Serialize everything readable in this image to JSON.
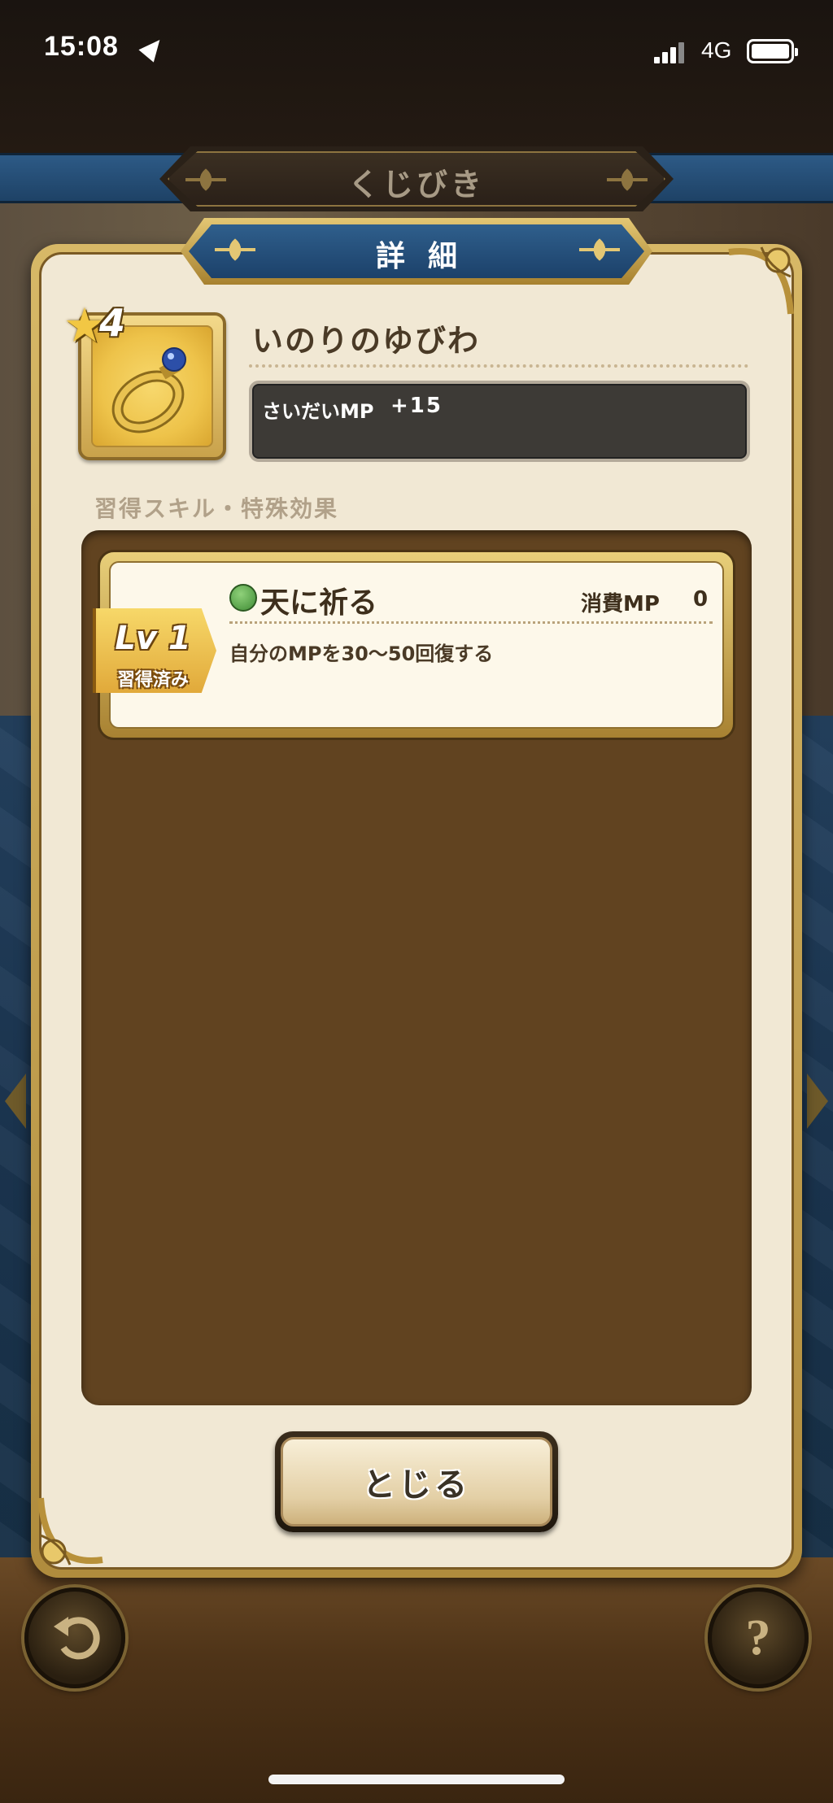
{
  "status_bar": {
    "time": "15:08",
    "network": "4G",
    "icons": [
      "location-arrow-icon",
      "signal-icon",
      "battery-icon"
    ]
  },
  "header": {
    "title": "くじびき"
  },
  "dialog": {
    "title": "詳細",
    "item": {
      "rarity_stars": "4",
      "name": "いのりのゆびわ",
      "icon": "ring-icon",
      "stat_label": "さいだいMP",
      "stat_value": "+15"
    },
    "section_heading": "習得スキル・特殊効果",
    "skills": [
      {
        "level": "Lv 1",
        "status": "習得済み",
        "type_icon": "green-skill-type-icon",
        "name": "天に祈る",
        "mp_label": "消費MP",
        "mp_value": "0",
        "description": "自分のMPを30～50回復する"
      }
    ],
    "close_label": "とじる"
  },
  "footer": {
    "back_icon": "back-arrow-icon",
    "help_icon": "question-mark-icon",
    "help_glyph": "?"
  },
  "colors": {
    "panel_background": "#f1e8d4",
    "gold_frame": "#c9a24b",
    "header_blue": "#1e4266",
    "skill_area_brown": "#614320"
  }
}
